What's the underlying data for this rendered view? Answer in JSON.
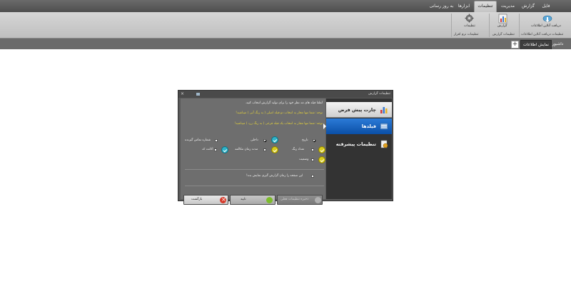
{
  "menu": {
    "items": [
      {
        "label": "فایل"
      },
      {
        "label": "گزارش"
      },
      {
        "label": "مدیریت"
      },
      {
        "label": "تنظیمات"
      },
      {
        "label": "ابزارها"
      },
      {
        "label": "به روز رسانی"
      }
    ],
    "active": "تنظیمات"
  },
  "ribbon": {
    "receive_button": "دریافت آنلاین اطلاعات",
    "receive_group": "تنظیمات دریافت آنلاین اطلاعات",
    "report_button": "گزارش",
    "report_group": "تنظیمات گزارش",
    "settings_button": "تنظیمات",
    "settings_group": "تنظیمات نرم افزار"
  },
  "tabs": {
    "dashboard": "داشبورد",
    "info": "نمایش اطلاعات",
    "add": "+"
  },
  "dialog": {
    "title": "تنظیمات گزارش",
    "close": "×",
    "instruction": "لطفا فیلد های مد نظر خود را برای تولید گزارش انتخاب کنید.",
    "note_primary": "توجه: شما تنها مجاز به انتخاب دو فیلد اصلی ( به رنگ آبی ) میباشید!",
    "note_secondary": "توجه: شما تنها مجاز به انتخاب یک فیلد فرعی ( به رنگ زرد ) میباشید!",
    "fields": {
      "date": "تاریخ",
      "internal": "داخلی",
      "caller_number": "شماره تماس گیرنده",
      "ring_count": "تعداد زنگ",
      "talk_duration": "مدت زمان مکالمه",
      "account_code": "اکانت کد",
      "status": "وضعیت"
    },
    "show_on_startup": "این صفحه را زمان گزارش گیری نمایش بده!",
    "buttons": {
      "back": "بازگشت",
      "ok": "تایید",
      "save": "ذخیره تنظیمات فعلی"
    },
    "side": {
      "default_chart": "چارت پیش فرض",
      "fields": "فیلدها",
      "advanced": "تنظیمات پیشرفته"
    }
  }
}
